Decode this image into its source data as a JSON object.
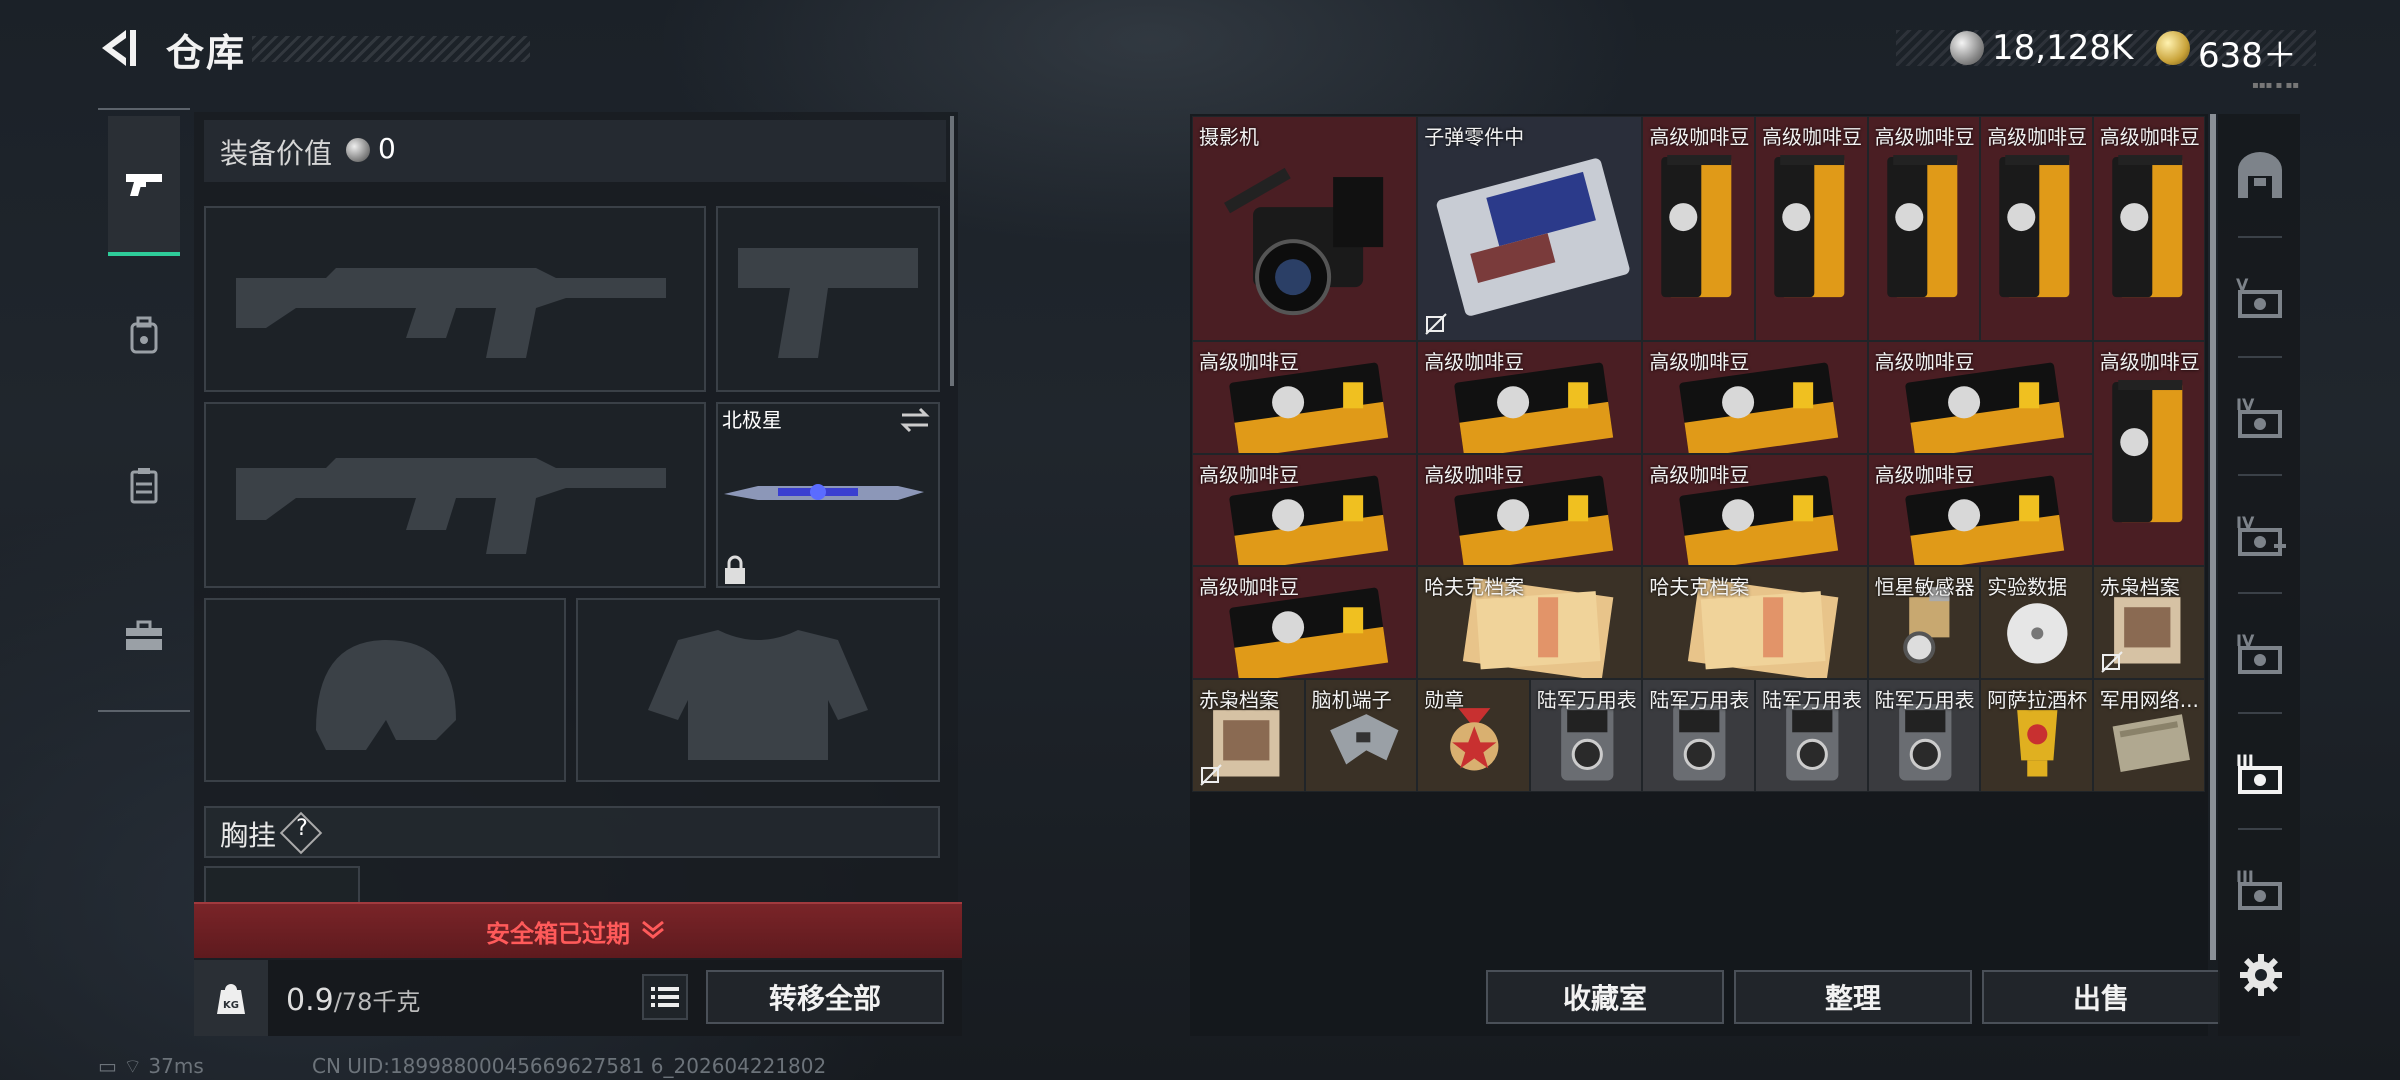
{
  "header": {
    "title": "仓库",
    "currency_silver": "18,128K",
    "currency_gold": "638＋"
  },
  "equipment": {
    "value_label": "装备价值",
    "value": "0",
    "melee_name": "北极星",
    "chest_rig_label": "胸挂",
    "help_mark": "?",
    "safebox_status": "安全箱已过期",
    "weight": "0.9",
    "weight_capacity": "/78千克",
    "kg_badge": "KG",
    "transfer_all": "转移全部"
  },
  "status": {
    "ping": "37ms",
    "uid": "CN UID:18998800045669627581 6_202604221802"
  },
  "stash": {
    "items": [
      {
        "name": "摄影机"
      },
      {
        "name": "子弹零件中"
      },
      {
        "name": "高级咖啡豆"
      },
      {
        "name": "高级咖啡豆"
      },
      {
        "name": "高级咖啡豆"
      },
      {
        "name": "高级咖啡豆"
      },
      {
        "name": "高级咖啡豆"
      },
      {
        "name": "高级咖啡豆"
      },
      {
        "name": "高级咖啡豆"
      },
      {
        "name": "高级咖啡豆"
      },
      {
        "name": "高级咖啡豆"
      },
      {
        "name": "高级咖啡豆"
      },
      {
        "name": "高级咖啡豆"
      },
      {
        "name": "高级咖啡豆"
      },
      {
        "name": "高级咖啡豆"
      },
      {
        "name": "高级咖啡豆"
      },
      {
        "name": "高级咖啡豆"
      },
      {
        "name": "哈夫克档案"
      },
      {
        "name": "哈夫克档案"
      },
      {
        "name": "恒星敏感器"
      },
      {
        "name": "实验数据"
      },
      {
        "name": "赤枭档案"
      },
      {
        "name": "赤枭档案"
      },
      {
        "name": "脑机端子"
      },
      {
        "name": "勋章"
      },
      {
        "name": "陆军万用表"
      },
      {
        "name": "陆军万用表"
      },
      {
        "name": "陆军万用表"
      },
      {
        "name": "陆军万用表"
      },
      {
        "name": "阿萨拉酒杯"
      },
      {
        "name": "军用网络..."
      }
    ],
    "buttons": {
      "collection": "收藏室",
      "sort": "整理",
      "sell": "出售"
    }
  },
  "rail_icons": [
    "home-icon",
    "case-v-icon",
    "case-iv-icon",
    "case-iv-plus-icon",
    "case-iv-icon",
    "case-iii-icon",
    "case-iii-icon",
    "gear-icon"
  ],
  "colors": {
    "accent_green": "#2ecc9a",
    "expired_red": "#ff5a5a",
    "item_red_bg": "#4a1e23"
  }
}
